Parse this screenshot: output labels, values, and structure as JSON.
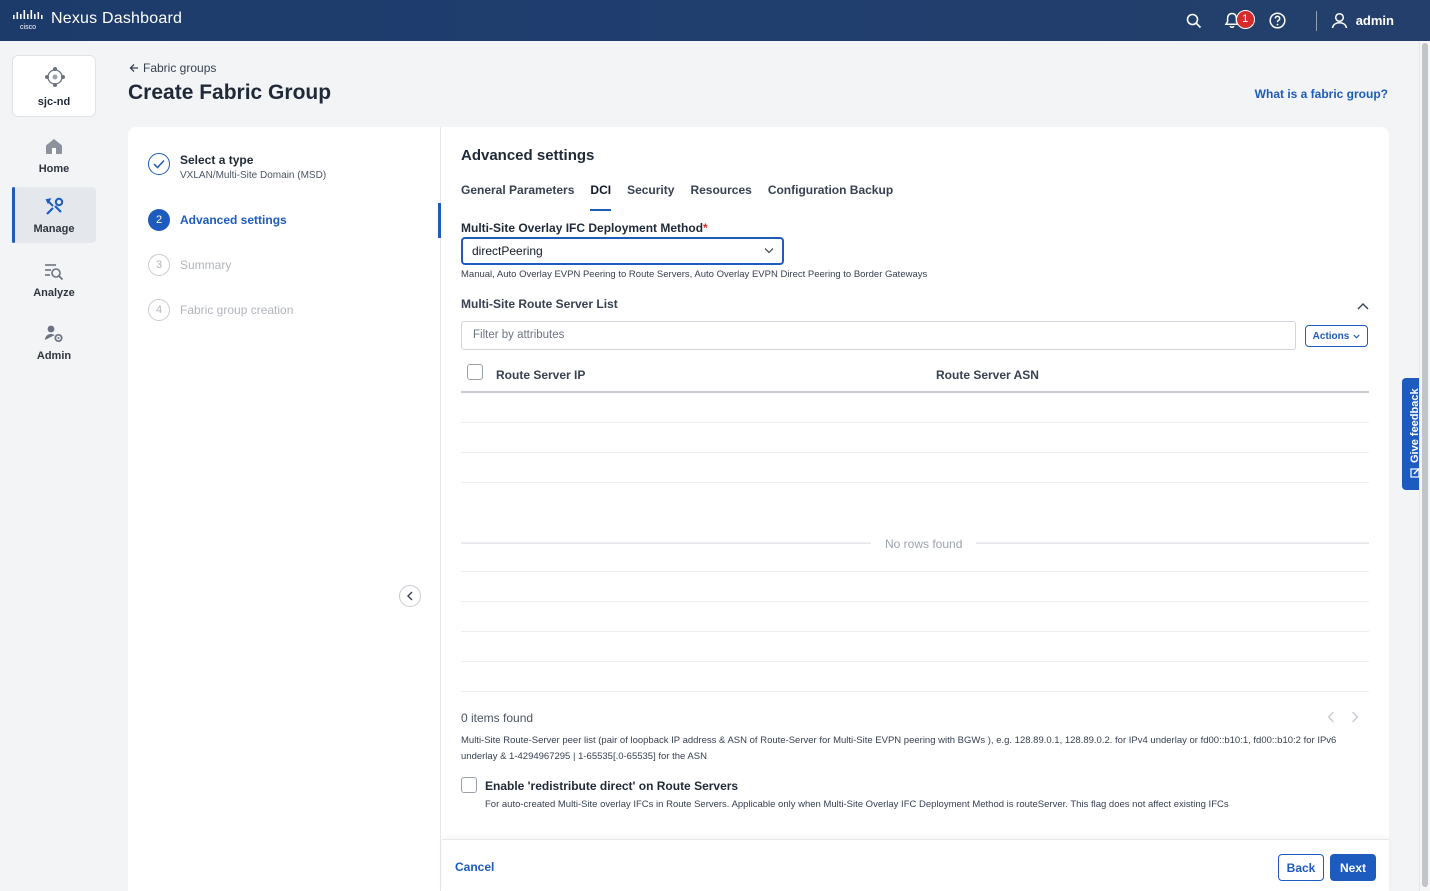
{
  "app": {
    "title": "Nexus Dashboard",
    "brand": "cisco",
    "notification_count": "1",
    "user": "admin"
  },
  "colors": {
    "topbar": "#1f3e6f",
    "accent": "#1d5bbf",
    "badge": "#d62b2b"
  },
  "sidebar": {
    "site": "sjc-nd",
    "items": [
      {
        "label": "Home",
        "icon": "home-icon"
      },
      {
        "label": "Manage",
        "icon": "tools-icon",
        "active": true
      },
      {
        "label": "Analyze",
        "icon": "analyze-icon"
      },
      {
        "label": "Admin",
        "icon": "admin-icon"
      }
    ]
  },
  "header": {
    "breadcrumb": "Fabric groups",
    "title": "Create Fabric Group",
    "help_link": "What is a fabric group?"
  },
  "steps": [
    {
      "num": "",
      "title": "Select a type",
      "subtitle": "VXLAN/Multi-Site Domain (MSD)",
      "state": "done"
    },
    {
      "num": "2",
      "title": "Advanced settings",
      "state": "active"
    },
    {
      "num": "3",
      "title": "Summary",
      "state": "todo"
    },
    {
      "num": "4",
      "title": "Fabric group creation",
      "state": "todo"
    }
  ],
  "main": {
    "section_title": "Advanced settings",
    "tabs": [
      "General Parameters",
      "DCI",
      "Security",
      "Resources",
      "Configuration Backup"
    ],
    "active_tab": "DCI",
    "deploy_method": {
      "label": "Multi-Site Overlay IFC Deployment Method",
      "required_mark": "*",
      "value": "directPeering",
      "help": "Manual, Auto Overlay EVPN Peering to Route Servers, Auto Overlay EVPN Direct Peering to Border Gateways"
    },
    "route_server_list": {
      "title": "Multi-Site Route Server List",
      "filter_placeholder": "Filter by attributes",
      "actions_label": "Actions",
      "columns": [
        "Route Server IP",
        "Route Server ASN"
      ],
      "rows": [],
      "empty_text": "No rows found",
      "items_found": "0 items found",
      "help": "Multi-Site Route-Server peer list (pair of loopback IP address & ASN of Route-Server for Multi-Site EVPN peering with BGWs ), e.g. 128.89.0.1, 128.89.0.2. for IPv4 underlay or fd00::b10:1, fd00::b10:2 for IPv6 underlay & 1-4294967295 | 1-65535[.0-65535] for the ASN"
    },
    "redistribute": {
      "label": "Enable 'redistribute direct' on Route Servers",
      "checked": false,
      "help": "For auto-created Multi-Site overlay IFCs in Route Servers. Applicable only when Multi-Site Overlay IFC Deployment Method is routeServer. This flag does not affect existing IFCs"
    }
  },
  "footer": {
    "cancel": "Cancel",
    "back": "Back",
    "next": "Next"
  },
  "feedback": {
    "label": "Give feedback"
  }
}
